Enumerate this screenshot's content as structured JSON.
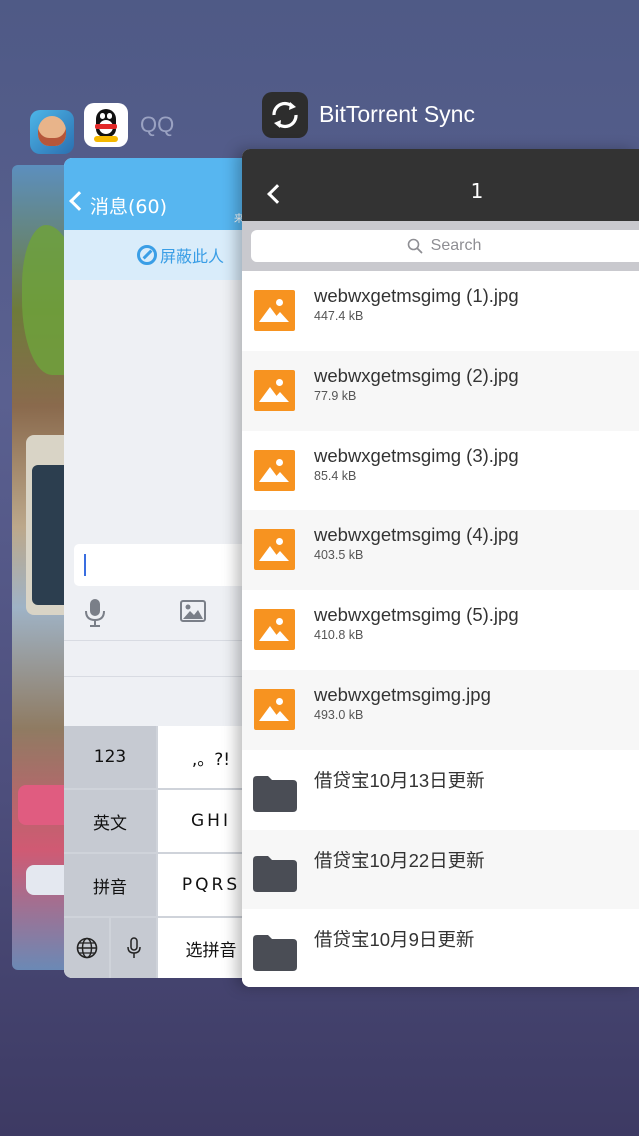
{
  "switcher": {
    "qq_app_label": "QQ",
    "bt_app_label": "BitTorrent Sync"
  },
  "qq": {
    "header_title": "消息(60)",
    "header_tail": "来",
    "block_label": "屏蔽此人",
    "keyboard": {
      "key_123": "123",
      "key_punct": ",。?!",
      "key_english": "英文",
      "key_ghi": "GHI",
      "key_pinyin": "拼音",
      "key_pqrs": "PQRS",
      "key_select_pinyin": "选拼音"
    }
  },
  "bt": {
    "nav_title": "1",
    "search_placeholder": "Search",
    "files": [
      {
        "name": "webwxgetmsgimg (1).jpg",
        "size": "447.4 kB",
        "type": "image"
      },
      {
        "name": "webwxgetmsgimg (2).jpg",
        "size": "77.9 kB",
        "type": "image"
      },
      {
        "name": "webwxgetmsgimg (3).jpg",
        "size": "85.4 kB",
        "type": "image"
      },
      {
        "name": "webwxgetmsgimg (4).jpg",
        "size": "403.5 kB",
        "type": "image"
      },
      {
        "name": "webwxgetmsgimg (5).jpg",
        "size": "410.8 kB",
        "type": "image"
      },
      {
        "name": "webwxgetmsgimg.jpg",
        "size": "493.0 kB",
        "type": "image"
      },
      {
        "name": "借贷宝10月13日更新",
        "type": "folder"
      },
      {
        "name": "借贷宝10月22日更新",
        "type": "folder"
      },
      {
        "name": "借贷宝10月9日更新",
        "type": "folder"
      }
    ]
  },
  "colors": {
    "qq_header": "#57b6f0",
    "bt_nav": "#333333",
    "image_thumb": "#f79320",
    "folder": "#4a4d55"
  }
}
